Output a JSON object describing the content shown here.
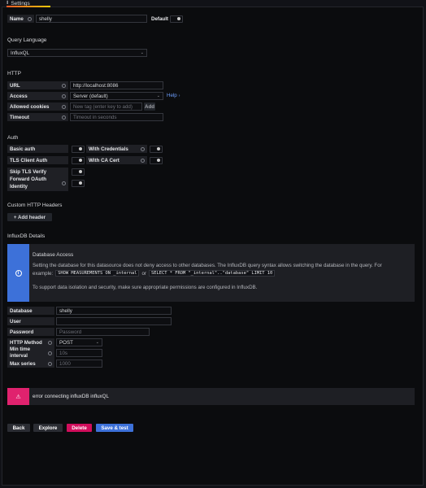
{
  "tab": {
    "label": "Settings"
  },
  "name_row": {
    "label": "Name",
    "value": "shelly",
    "default_label": "Default"
  },
  "query_language": {
    "title": "Query Language",
    "value": "InfluxQL"
  },
  "http": {
    "title": "HTTP",
    "url_label": "URL",
    "url_value": "http://localhost:8086",
    "access_label": "Access",
    "access_value": "Server (default)",
    "help_label": "Help",
    "cookies_label": "Allowed cookies",
    "cookies_placeholder": "New tag (enter key to add)",
    "add_label": "Add",
    "timeout_label": "Timeout",
    "timeout_placeholder": "Timeout in seconds"
  },
  "auth": {
    "title": "Auth",
    "basic_auth": "Basic auth",
    "with_credentials": "With Credentials",
    "tls_client_auth": "TLS Client Auth",
    "with_ca_cert": "With CA Cert",
    "skip_tls": "Skip TLS Verify",
    "forward_oauth_line1": "Forward OAuth",
    "forward_oauth_line2": "Identity"
  },
  "custom_headers": {
    "title": "Custom HTTP Headers",
    "add_header": "+ Add header"
  },
  "influx": {
    "title": "InfluxDB Details",
    "alert_title": "Database Access",
    "alert_text1": "Setting the database for this datasource does not deny access to other databases. The InfluxDB query syntax allows switching the database in the query. For",
    "alert_example_prefix": "example:",
    "alert_code1": "SHOW MEASUREMENTS ON _internal",
    "alert_or": "or",
    "alert_code2": "SELECT * FROM \"_internal\"..\"database\" LIMIT 10",
    "alert_text2": "To support data isolation and security, make sure appropriate permissions are configured in InfluxDB.",
    "database_label": "Database",
    "database_value": "shelly",
    "user_label": "User",
    "user_value": "",
    "password_label": "Password",
    "password_placeholder": "Password",
    "method_label": "HTTP Method",
    "method_value": "POST",
    "min_time_line1": "Min time",
    "min_time_line2": "interval",
    "min_time_placeholder": "10s",
    "max_series_label": "Max series",
    "max_series_placeholder": "1000"
  },
  "error": {
    "text": "error connecting influxDB influxQL"
  },
  "buttons": {
    "back": "Back",
    "explore": "Explore",
    "delete": "Delete",
    "save": "Save & test"
  },
  "colors": {
    "alert_blue": "#3d71d9",
    "error_red": "#e0226e",
    "delete": "#d10e5c",
    "save": "#3d71d9"
  }
}
